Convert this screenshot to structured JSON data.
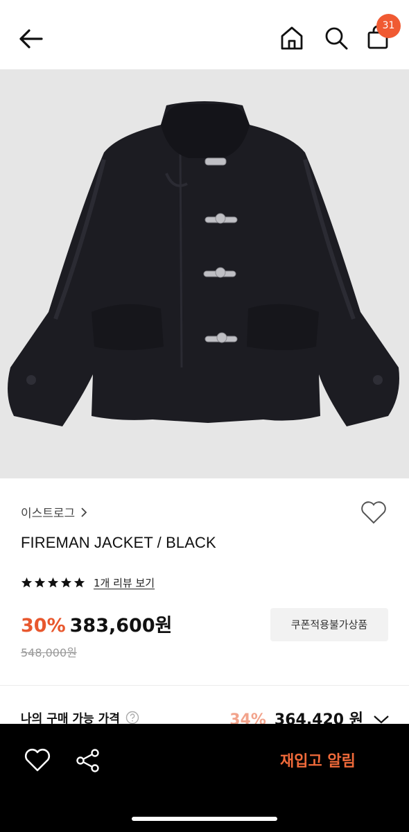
{
  "header": {
    "back_icon": "arrow-left-icon",
    "home_icon": "home-icon",
    "search_icon": "search-icon",
    "cart_icon": "shopping-bag-icon",
    "cart_count": "31"
  },
  "product": {
    "image": "black-fireman-jacket-photo",
    "brand": "이스트로그",
    "name": "FIREMAN JACKET / BLACK",
    "rating_stars": 5,
    "review_link": "1개 리뷰 보기",
    "discount": "30%",
    "price": "383,600원",
    "original_price": "548,000원",
    "coupon_label": "쿠폰적용불가상품"
  },
  "my_price": {
    "label": "나의 구매 가능 가격",
    "discount": "34%",
    "price": "364,420 원"
  },
  "bottom_bar": {
    "wish_icon": "heart-icon",
    "share_icon": "share-icon",
    "restock_label": "재입고 알림"
  },
  "colors": {
    "accent": "#e8582e",
    "badge": "#f05a32",
    "bar": "#000000"
  }
}
